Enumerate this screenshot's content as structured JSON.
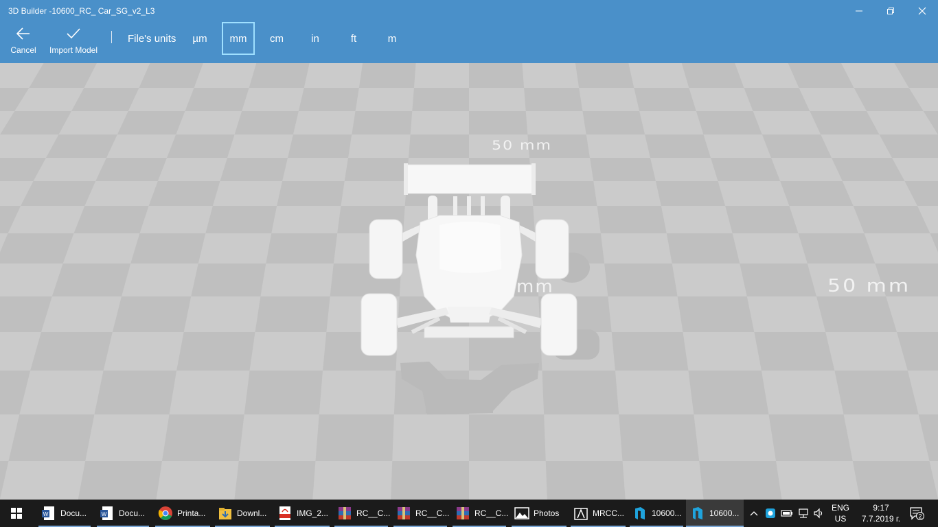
{
  "window": {
    "title": "3D Builder -10600_RC_ Car_SG_v2_L3"
  },
  "toolbar": {
    "cancel_label": "Cancel",
    "import_label": "Import Model",
    "units_label": "File's units",
    "units": [
      "µm",
      "mm",
      "cm",
      "in",
      "ft",
      "m"
    ],
    "selected_unit": "mm",
    "accent_color": "#4a90c9"
  },
  "viewport": {
    "scale_label_top": "50 mm",
    "scale_label_right": "50 mm",
    "scale_label_hidden": "mm"
  },
  "taskbar": {
    "items": [
      {
        "label": "Docu...",
        "icon": "word-doc-icon"
      },
      {
        "label": "Docu...",
        "icon": "word-doc-icon"
      },
      {
        "label": "Printa...",
        "icon": "chrome-icon"
      },
      {
        "label": "Downl...",
        "icon": "folder-download-icon"
      },
      {
        "label": "IMG_2...",
        "icon": "pdf-icon"
      },
      {
        "label": "RC__C...",
        "icon": "winrar-icon"
      },
      {
        "label": "RC__C...",
        "icon": "winrar-icon"
      },
      {
        "label": "RC__C...",
        "icon": "winrar-icon"
      },
      {
        "label": "Photos",
        "icon": "photos-icon"
      },
      {
        "label": "MRCC...",
        "icon": "app-icon"
      },
      {
        "label": "10600...",
        "icon": "3d-builder-icon"
      },
      {
        "label": "10600...",
        "icon": "3d-builder-icon"
      }
    ],
    "lang_line1": "ENG",
    "lang_line2": "US",
    "time": "9:17",
    "date": "7.7.2019 г.",
    "notification_count": "2"
  }
}
